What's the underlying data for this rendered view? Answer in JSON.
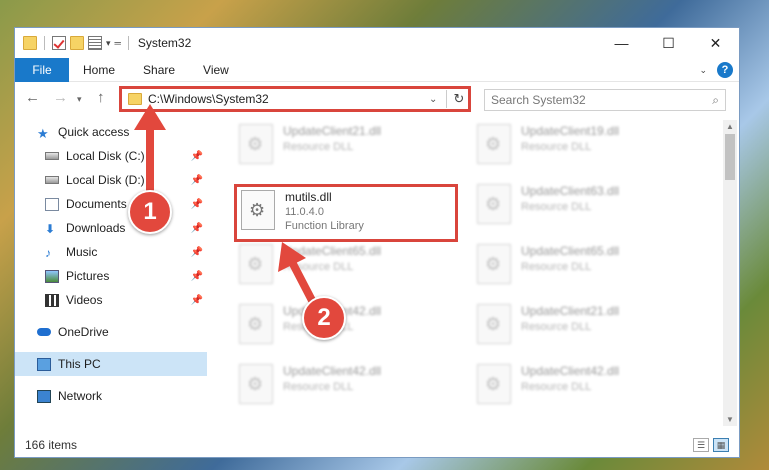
{
  "titlebar": {
    "title": "System32",
    "minimize": "—",
    "maximize": "☐",
    "close": "✕"
  },
  "ribbon": {
    "tabs": [
      "File",
      "Home",
      "Share",
      "View"
    ],
    "help": "?"
  },
  "addressbar": {
    "path": "C:\\Windows\\System32",
    "search_placeholder": "Search System32"
  },
  "sidebar": {
    "quick_access": "Quick access",
    "items": [
      {
        "label": "Local Disk (C:)",
        "icon": "disk-icon"
      },
      {
        "label": "Local Disk (D:)",
        "icon": "disk-icon"
      },
      {
        "label": "Documents",
        "icon": "documents-icon"
      },
      {
        "label": "Downloads",
        "icon": "downloads-icon"
      },
      {
        "label": "Music",
        "icon": "music-icon"
      },
      {
        "label": "Pictures",
        "icon": "pictures-icon"
      },
      {
        "label": "Videos",
        "icon": "videos-icon"
      }
    ],
    "onedrive": "OneDrive",
    "thispc": "This PC",
    "network": "Network"
  },
  "files": {
    "focused": {
      "name": "mutils.dll",
      "version": "11.0.4.0",
      "type": "Function Library"
    },
    "blurred": [
      {
        "name": "UpdateClient21.dll",
        "type": "Resource DLL"
      },
      {
        "name": "UpdateClient19.dll",
        "type": "Resource DLL"
      },
      {
        "name": "UpdateClient63.dll",
        "type": "Resource DLL"
      },
      {
        "name": "UpdateClient65.dll",
        "type": "Resource DLL"
      },
      {
        "name": "UpdateClient65.dll",
        "type": "Resource DLL"
      },
      {
        "name": "UpdateClient42.dll",
        "type": "Resource DLL"
      },
      {
        "name": "UpdateClient21.dll",
        "type": "Resource DLL"
      },
      {
        "name": "UpdateClient42.dll",
        "type": "Resource DLL"
      },
      {
        "name": "UpdateClient42.dll",
        "type": "Resource DLL"
      }
    ]
  },
  "status": {
    "count": "166 items"
  },
  "annotations": {
    "step1": "1",
    "step2": "2"
  },
  "colors": {
    "accent": "#1979ca",
    "highlight": "#d9453c"
  }
}
